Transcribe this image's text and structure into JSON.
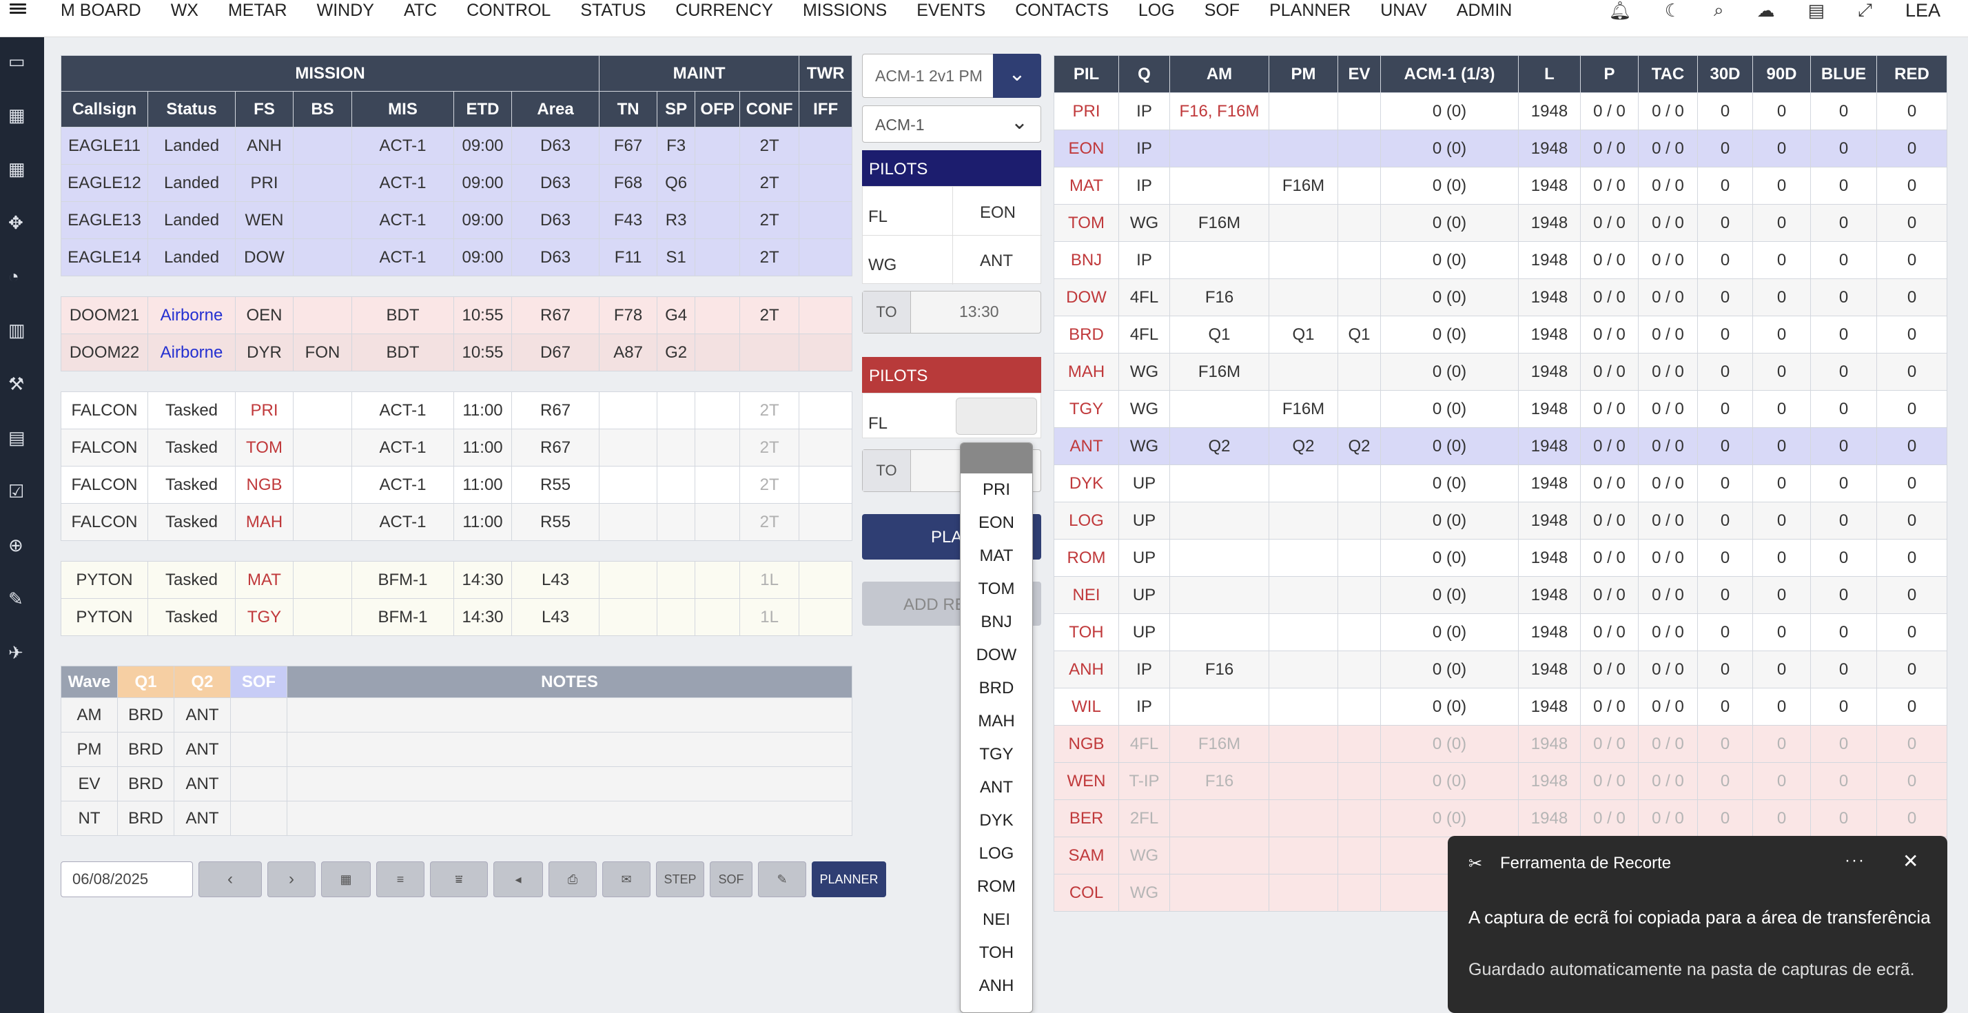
{
  "nav": {
    "items": [
      "M BOARD",
      "WX",
      "METAR",
      "WINDY",
      "ATC",
      "CONTROL",
      "STATUS",
      "CURRENCY",
      "MISSIONS",
      "EVENTS",
      "CONTACTS",
      "LOG",
      "SOF",
      "PLANNER",
      "UNAV",
      "ADMIN"
    ],
    "user": "LEA",
    "icons": [
      "bell-icon",
      "moon-icon",
      "search-icon",
      "weather-icon",
      "document-icon",
      "expand-icon"
    ]
  },
  "sidebar": {
    "icons": [
      "monitor-icon",
      "calendar-icon",
      "calendar-check-icon",
      "puzzle-icon",
      "gauge-icon",
      "bar-chart-icon",
      "hammer-icon",
      "list-document-icon",
      "checklist-icon",
      "target-icon",
      "pen-icon",
      "aircraft-icon"
    ]
  },
  "mission": {
    "group_headers": {
      "mission": "MISSION",
      "maint": "MAINT",
      "twr": "TWR"
    },
    "columns": [
      "Callsign",
      "Status",
      "FS",
      "BS",
      "MIS",
      "ETD",
      "Area",
      "TN",
      "SP",
      "OFP",
      "CONF",
      "IFF"
    ],
    "groups": [
      {
        "style": "blue",
        "rows": [
          [
            "EAGLE11",
            "Landed",
            "ANH",
            "",
            "ACT-1",
            "09:00",
            "D63",
            "F67",
            "F3",
            "",
            "2T",
            ""
          ],
          [
            "EAGLE12",
            "Landed",
            "PRI",
            "",
            "ACT-1",
            "09:00",
            "D63",
            "F68",
            "Q6",
            "",
            "2T",
            ""
          ],
          [
            "EAGLE13",
            "Landed",
            "WEN",
            "",
            "ACT-1",
            "09:00",
            "D63",
            "F43",
            "R3",
            "",
            "2T",
            ""
          ],
          [
            "EAGLE14",
            "Landed",
            "DOW",
            "",
            "ACT-1",
            "09:00",
            "D63",
            "F11",
            "S1",
            "",
            "2T",
            ""
          ]
        ]
      },
      {
        "style": "pink",
        "rows": [
          [
            "DOOM21",
            "Airborne",
            "OEN",
            "",
            "BDT",
            "10:55",
            "R67",
            "F78",
            "G4",
            "",
            "2T",
            ""
          ],
          [
            "DOOM22",
            "Airborne",
            "DYR",
            "FON",
            "BDT",
            "10:55",
            "D67",
            "A87",
            "G2",
            "",
            "",
            ""
          ]
        ]
      },
      {
        "style": "white",
        "rows": [
          [
            "FALCON",
            "Tasked",
            "PRI",
            "",
            "ACT-1",
            "11:00",
            "R67",
            "",
            "",
            "",
            "2T",
            ""
          ],
          [
            "FALCON",
            "Tasked",
            "TOM",
            "",
            "ACT-1",
            "11:00",
            "R67",
            "",
            "",
            "",
            "2T",
            ""
          ],
          [
            "FALCON",
            "Tasked",
            "NGB",
            "",
            "ACT-1",
            "11:00",
            "R55",
            "",
            "",
            "",
            "2T",
            ""
          ],
          [
            "FALCON",
            "Tasked",
            "MAH",
            "",
            "ACT-1",
            "11:00",
            "R55",
            "",
            "",
            "",
            "2T",
            ""
          ]
        ]
      },
      {
        "style": "cream",
        "rows": [
          [
            "PYTON",
            "Tasked",
            "MAT",
            "",
            "BFM-1",
            "14:30",
            "L43",
            "",
            "",
            "",
            "1L",
            ""
          ],
          [
            "PYTON",
            "Tasked",
            "TGY",
            "",
            "BFM-1",
            "14:30",
            "L43",
            "",
            "",
            "",
            "1L",
            ""
          ]
        ]
      }
    ]
  },
  "waves": {
    "headers": [
      "Wave",
      "Q1",
      "Q2",
      "SOF",
      "NOTES"
    ],
    "rows": [
      [
        "AM",
        "BRD",
        "ANT",
        ""
      ],
      [
        "PM",
        "BRD",
        "ANT",
        ""
      ],
      [
        "EV",
        "BRD",
        "ANT",
        ""
      ],
      [
        "NT",
        "BRD",
        "ANT",
        ""
      ]
    ]
  },
  "toolbar": {
    "date": "06/08/2025",
    "step": "STEP",
    "sof": "SOF",
    "planner": "PLANNER"
  },
  "mid": {
    "select1": "ACM-1 2v1 PM",
    "select2": "ACM-1",
    "pilots_label": "PILOTS",
    "fl_label": "FL",
    "fl_value": "EON",
    "wg_label": "WG",
    "wg_value": "ANT",
    "to_label": "TO",
    "to_value": "13:30",
    "pilots2_label": "PILOTS",
    "fl2_label": "FL",
    "to2_label": "TO",
    "plan_btn": "PLA",
    "add_btn": "ADD RE"
  },
  "dropdown": {
    "options": [
      "PRI",
      "EON",
      "MAT",
      "TOM",
      "BNJ",
      "DOW",
      "BRD",
      "MAH",
      "TGY",
      "ANT",
      "DYK",
      "LOG",
      "ROM",
      "NEI",
      "TOH",
      "ANH"
    ]
  },
  "pilots": {
    "columns": [
      "PIL",
      "Q",
      "AM",
      "PM",
      "EV",
      "ACM-1 (1/3)",
      "L",
      "P",
      "TAC",
      "30D",
      "90D",
      "BLUE",
      "RED"
    ],
    "rows": [
      [
        "PRI",
        "IP",
        "F16, F16M",
        "",
        "",
        "0 (0)",
        "1948",
        "0 / 0",
        "0 / 0",
        "0",
        "0",
        "0",
        "0"
      ],
      [
        "EON",
        "IP",
        "",
        "",
        "",
        "0 (0)",
        "1948",
        "0 / 0",
        "0 / 0",
        "0",
        "0",
        "0",
        "0"
      ],
      [
        "MAT",
        "IP",
        "",
        "F16M",
        "",
        "0 (0)",
        "1948",
        "0 / 0",
        "0 / 0",
        "0",
        "0",
        "0",
        "0"
      ],
      [
        "TOM",
        "WG",
        "F16M",
        "",
        "",
        "0 (0)",
        "1948",
        "0 / 0",
        "0 / 0",
        "0",
        "0",
        "0",
        "0"
      ],
      [
        "BNJ",
        "IP",
        "",
        "",
        "",
        "0 (0)",
        "1948",
        "0 / 0",
        "0 / 0",
        "0",
        "0",
        "0",
        "0"
      ],
      [
        "DOW",
        "4FL",
        "F16",
        "",
        "",
        "0 (0)",
        "1948",
        "0 / 0",
        "0 / 0",
        "0",
        "0",
        "0",
        "0"
      ],
      [
        "BRD",
        "4FL",
        "Q1",
        "Q1",
        "Q1",
        "0 (0)",
        "1948",
        "0 / 0",
        "0 / 0",
        "0",
        "0",
        "0",
        "0"
      ],
      [
        "MAH",
        "WG",
        "F16M",
        "",
        "",
        "0 (0)",
        "1948",
        "0 / 0",
        "0 / 0",
        "0",
        "0",
        "0",
        "0"
      ],
      [
        "TGY",
        "WG",
        "",
        "F16M",
        "",
        "0 (0)",
        "1948",
        "0 / 0",
        "0 / 0",
        "0",
        "0",
        "0",
        "0"
      ],
      [
        "ANT",
        "WG",
        "Q2",
        "Q2",
        "Q2",
        "0 (0)",
        "1948",
        "0 / 0",
        "0 / 0",
        "0",
        "0",
        "0",
        "0"
      ],
      [
        "DYK",
        "UP",
        "",
        "",
        "",
        "0 (0)",
        "1948",
        "0 / 0",
        "0 / 0",
        "0",
        "0",
        "0",
        "0"
      ],
      [
        "LOG",
        "UP",
        "",
        "",
        "",
        "0 (0)",
        "1948",
        "0 / 0",
        "0 / 0",
        "0",
        "0",
        "0",
        "0"
      ],
      [
        "ROM",
        "UP",
        "",
        "",
        "",
        "0 (0)",
        "1948",
        "0 / 0",
        "0 / 0",
        "0",
        "0",
        "0",
        "0"
      ],
      [
        "NEI",
        "UP",
        "",
        "",
        "",
        "0 (0)",
        "1948",
        "0 / 0",
        "0 / 0",
        "0",
        "0",
        "0",
        "0"
      ],
      [
        "TOH",
        "UP",
        "",
        "",
        "",
        "0 (0)",
        "1948",
        "0 / 0",
        "0 / 0",
        "0",
        "0",
        "0",
        "0"
      ],
      [
        "ANH",
        "IP",
        "F16",
        "",
        "",
        "0 (0)",
        "1948",
        "0 / 0",
        "0 / 0",
        "0",
        "0",
        "0",
        "0"
      ],
      [
        "WIL",
        "IP",
        "",
        "",
        "",
        "0 (0)",
        "1948",
        "0 / 0",
        "0 / 0",
        "0",
        "0",
        "0",
        "0"
      ],
      [
        "NGB",
        "4FL",
        "F16M",
        "",
        "",
        "0 (0)",
        "1948",
        "0 / 0",
        "0 / 0",
        "0",
        "0",
        "0",
        "0"
      ],
      [
        "WEN",
        "T-IP",
        "F16",
        "",
        "",
        "0 (0)",
        "1948",
        "0 / 0",
        "0 / 0",
        "0",
        "0",
        "0",
        "0"
      ],
      [
        "BER",
        "2FL",
        "",
        "",
        "",
        "0 (0)",
        "1948",
        "0 / 0",
        "0 / 0",
        "0",
        "0",
        "0",
        "0"
      ],
      [
        "SAM",
        "WG",
        "",
        "",
        "",
        "",
        "",
        "",
        "",
        "",
        "",
        "",
        ""
      ],
      [
        "COL",
        "WG",
        "",
        "",
        "",
        "",
        "",
        "",
        "",
        "",
        "",
        "",
        ""
      ]
    ]
  },
  "toast": {
    "title": "Ferramenta de Recorte",
    "line1": "A captura de ecrã foi copiada para a área de transferência",
    "line2": "Guardado automaticamente na pasta de capturas de ecrã."
  },
  "colors": {
    "header": "#3c4658",
    "blue_row": "#d8d9f7",
    "pink_row": "#fae6e6",
    "red_panel": "#b83a3a",
    "navy_panel": "#1c1d6e",
    "planner_btn": "#2f3e73",
    "orange": "#f5dfc2"
  }
}
